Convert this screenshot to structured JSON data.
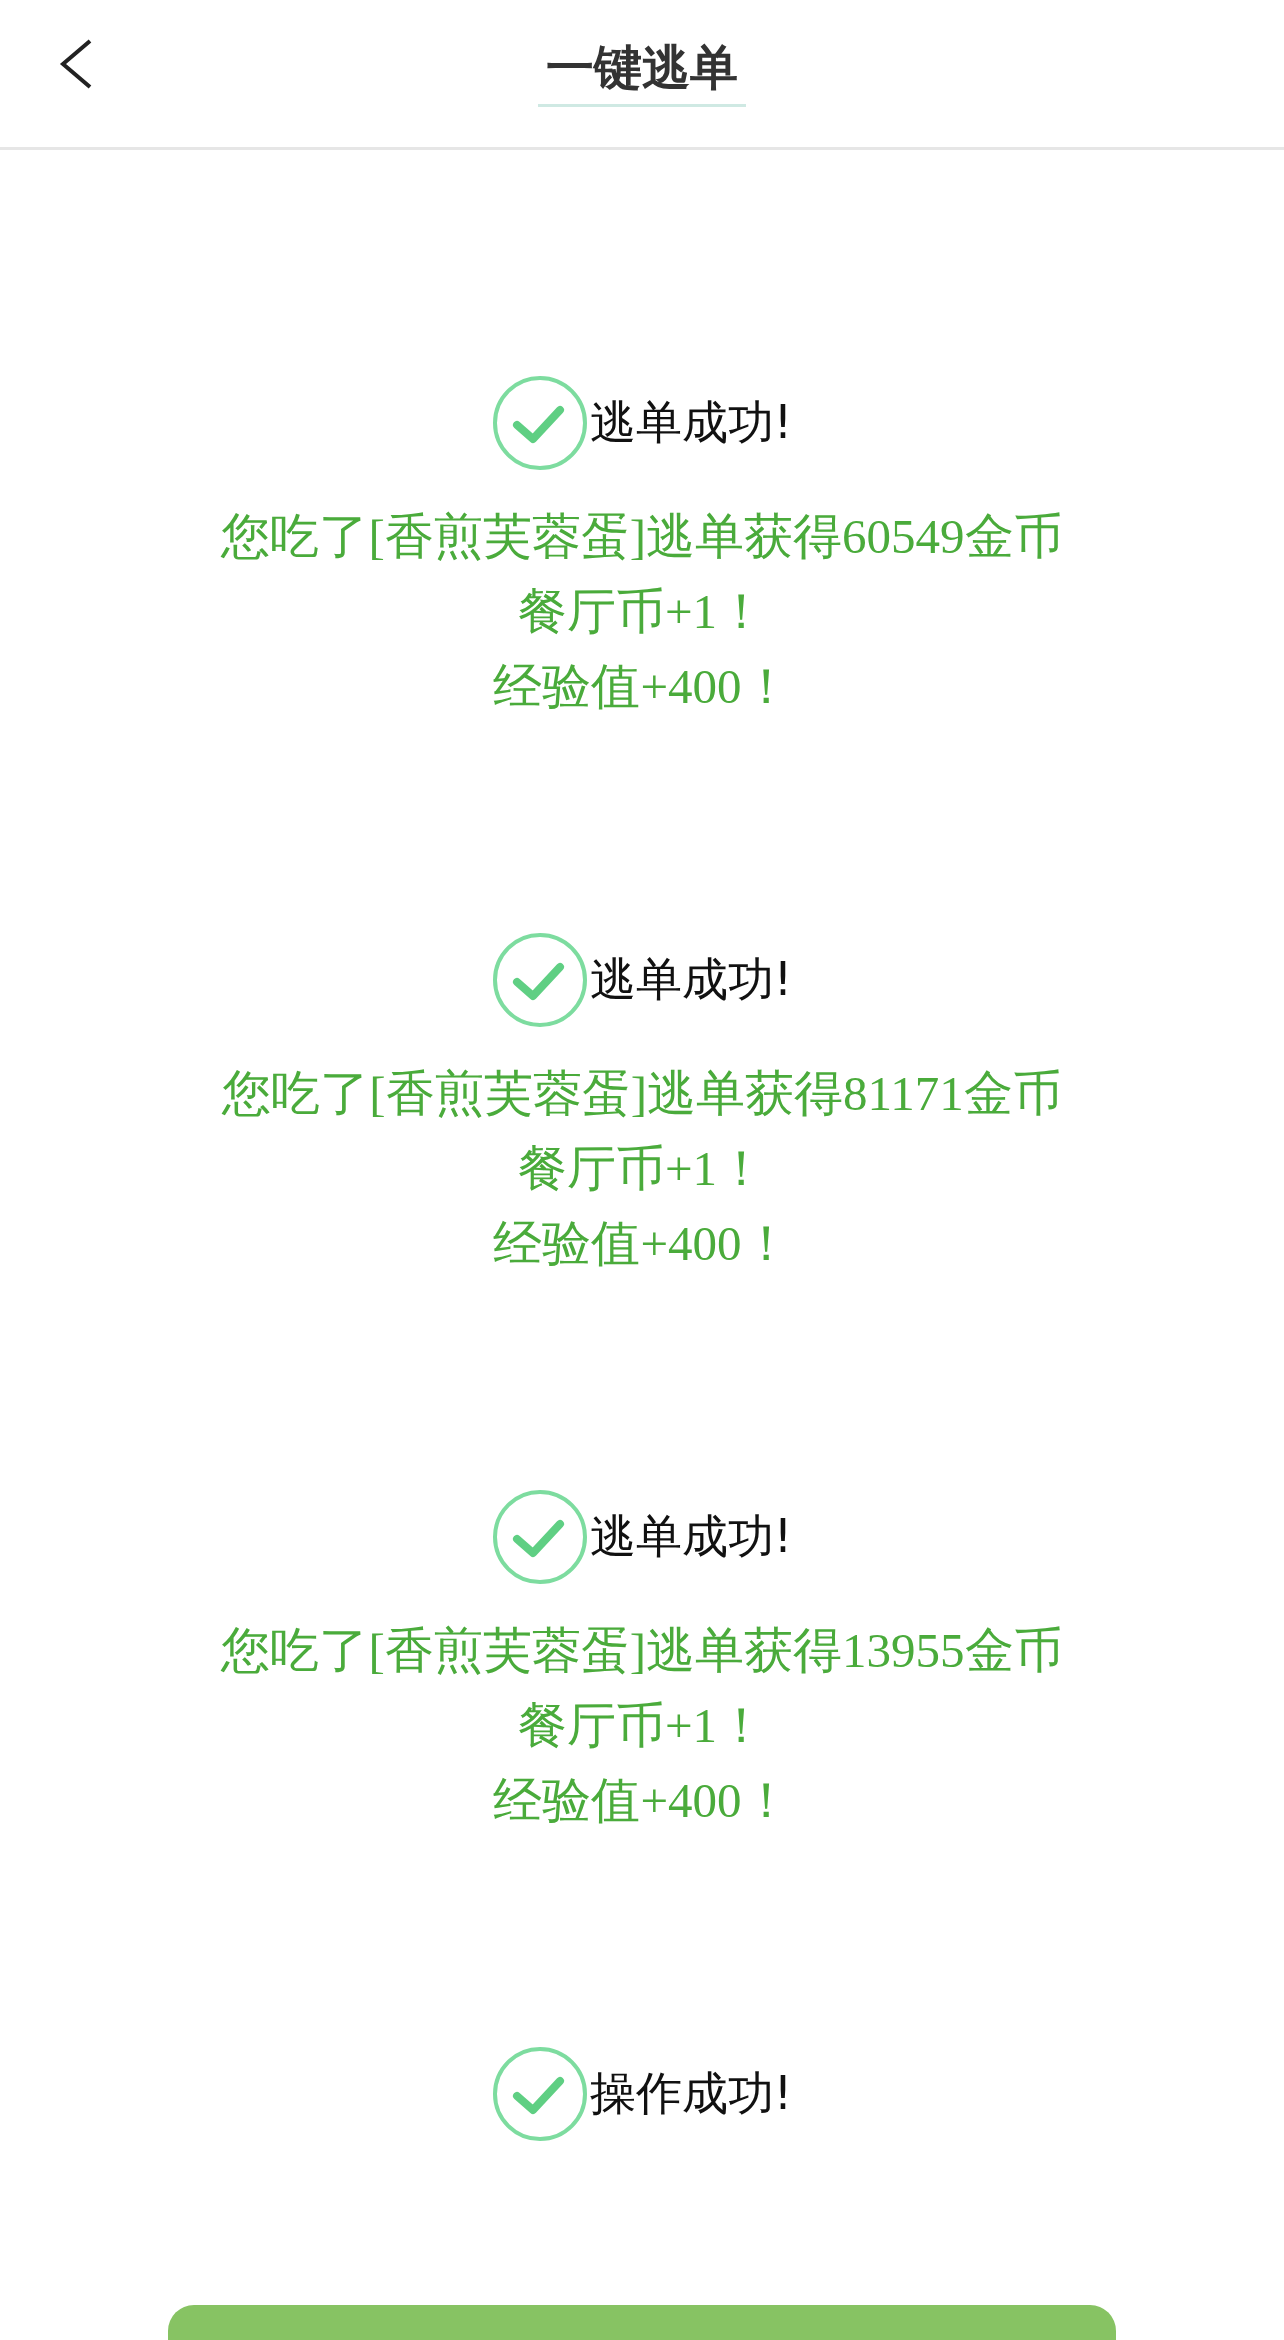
{
  "header": {
    "title": "一键逃单"
  },
  "results": [
    {
      "status": "逃单成功!",
      "lines": [
        "您吃了[香煎芙蓉蛋]逃单获得60549金币",
        "餐厅币+1！",
        "经验值+400！"
      ]
    },
    {
      "status": "逃单成功!",
      "lines": [
        "您吃了[香煎芙蓉蛋]逃单获得81171金币",
        "餐厅币+1！",
        "经验值+400！"
      ]
    },
    {
      "status": "逃单成功!",
      "lines": [
        "您吃了[香煎芙蓉蛋]逃单获得13955金币",
        "餐厅币+1！",
        "经验值+400！"
      ]
    }
  ],
  "final_status": "操作成功!"
}
